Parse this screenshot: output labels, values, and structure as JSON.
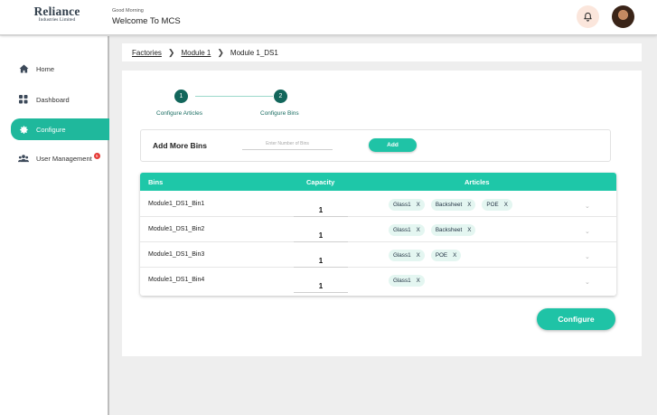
{
  "header": {
    "logo_name": "Reliance",
    "logo_sub": "Industries Limited",
    "greeting_small": "Good Morning",
    "greeting": "Welcome To MCS"
  },
  "sidebar": {
    "items": [
      {
        "label": "Home",
        "icon": "home-icon"
      },
      {
        "label": "Dashboard",
        "icon": "dashboard-icon"
      },
      {
        "label": "Configure",
        "icon": "gear-icon",
        "active": true
      },
      {
        "label": "User Management",
        "icon": "users-icon",
        "badge": "5"
      }
    ]
  },
  "breadcrumb": {
    "items": [
      "Factories",
      "Module 1",
      "Module 1_DS1"
    ]
  },
  "stepper": {
    "steps": [
      {
        "number": "1",
        "label": "Configure Articles"
      },
      {
        "number": "2",
        "label": "Configure Bins"
      }
    ]
  },
  "add_bins": {
    "title": "Add More Bins",
    "placeholder": "Enter Number of Bins",
    "button": "Add"
  },
  "table": {
    "headers": [
      "Bins",
      "Capacity",
      "Articles"
    ],
    "rows": [
      {
        "bin": "Module1_DS1_Bin1",
        "capacity": "1",
        "articles": [
          "Glass1",
          "Backsheet",
          "POE"
        ]
      },
      {
        "bin": "Module1_DS1_Bin2",
        "capacity": "1",
        "articles": [
          "Glass1",
          "Backsheet"
        ]
      },
      {
        "bin": "Module1_DS1_Bin3",
        "capacity": "1",
        "articles": [
          "Glass1",
          "POE"
        ]
      },
      {
        "bin": "Module1_DS1_Bin4",
        "capacity": "1",
        "articles": [
          "Glass1"
        ]
      }
    ],
    "chip_remove": "X"
  },
  "configure_button": "Configure",
  "colors": {
    "accent": "#1fc3a6",
    "step": "#12665b",
    "badge": "#e53935"
  }
}
